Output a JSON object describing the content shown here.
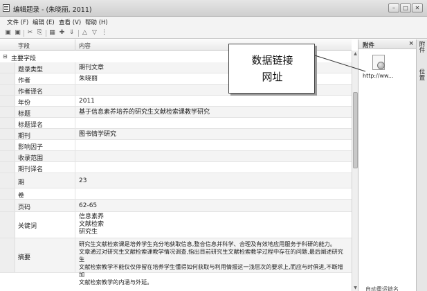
{
  "window": {
    "title": "编辑题录 - (朱晓丽, 2011)",
    "controls": [
      "–",
      "□",
      "✕"
    ]
  },
  "menu": [
    "文件 (F)",
    "编辑 (E)",
    "查看 (V)",
    "帮助 (H)"
  ],
  "toolbar": {
    "icons": [
      "save-icon",
      "save-close-icon",
      "cut-icon",
      "copy-icon",
      "grid-icon",
      "pin-icon",
      "import-icon",
      "up-icon",
      "down-icon",
      "more-icon"
    ],
    "glyphs": [
      "▣",
      "▣",
      "✂",
      "⎘",
      "▦",
      "✚",
      "⇓",
      "△",
      "▽",
      "⋮"
    ]
  },
  "table": {
    "headers": {
      "field": "字段",
      "content": "内容"
    },
    "group": {
      "toggle": "⊟",
      "label": "主要字段"
    },
    "rows": [
      {
        "field": "题录类型",
        "value": "期刊文章"
      },
      {
        "field": "作者",
        "value": "朱晓丽"
      },
      {
        "field": "作者译名",
        "value": ""
      },
      {
        "field": "年份",
        "value": "2011"
      },
      {
        "field": "标题",
        "value": "基于信息素养培养的研究生文献检索课教学研究"
      },
      {
        "field": "标题译名",
        "value": ""
      },
      {
        "field": "期刊",
        "value": "图书情学研究"
      },
      {
        "field": "影响因子",
        "value": ""
      },
      {
        "field": "收录范围",
        "value": ""
      },
      {
        "field": "期刊译名",
        "value": ""
      },
      {
        "field": "期",
        "value": "23"
      },
      {
        "field": "卷",
        "value": ""
      },
      {
        "field": "页码",
        "value": "62-65"
      },
      {
        "field": "关键词",
        "value": [
          "信息素养",
          "文献检索",
          "研究生"
        ]
      },
      {
        "field": "摘要",
        "value": [
          "研究生文献检索课是培养学生充分地获取信息,整合信息并科学、合理及有效地应用服务于科研的能力。",
          "文章通过对研究生文献检索课教学情况调查,指出目前研究生文献检索教学过程中存在的问题,最后阐述研究生",
          "文献检索教学不能仅仅停留在培养学生懂得如何获取与利用情报这一浅层次的要求上,而应与时俱进,不断增加",
          "文献检索教学的内涵与外延。"
        ]
      }
    ]
  },
  "attachments": {
    "title": "附件",
    "close": "×",
    "file_name": "http://ww...",
    "bottom_text": "自动重运链名"
  },
  "side_tabs": [
    "附件",
    "位置"
  ],
  "callout": {
    "line1": "数据链接",
    "line2": "网址"
  }
}
